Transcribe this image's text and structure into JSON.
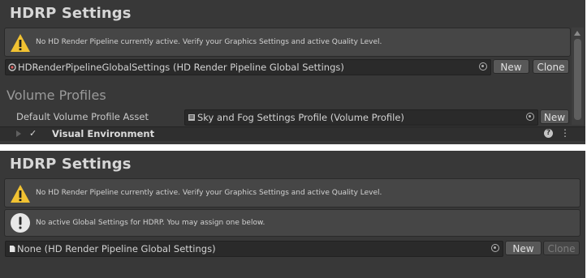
{
  "top": {
    "title": "HDRP Settings",
    "warning": "No HD Render Pipeline currently active. Verify your Graphics Settings and active Quality Level.",
    "global_settings_field": "HDRenderPipelineGlobalSettings (HD Render Pipeline Global Settings)",
    "new_label": "New",
    "clone_label": "Clone",
    "volume_profiles_header": "Volume Profiles",
    "default_profile_label": "Default Volume Profile Asset",
    "default_profile_value": "Sky and Fog Settings Profile (Volume Profile)",
    "profile_new_label": "New",
    "visual_env_label": "Visual Environment",
    "visual_env_checked": "✓"
  },
  "bottom": {
    "title": "HDRP Settings",
    "warning": "No HD Render Pipeline currently active. Verify your Graphics Settings and active Quality Level.",
    "info": "No active Global Settings for HDRP. You may assign one below.",
    "global_settings_field": "None (HD Render Pipeline Global Settings)",
    "new_label": "New",
    "clone_label": "Clone"
  },
  "icons": {
    "warning": "warning-icon",
    "info": "info-icon",
    "picker": "object-picker-icon",
    "asset": "asset-icon",
    "help": "help-icon",
    "menu": "kebab-menu-icon"
  },
  "colors": {
    "panel_bg": "#383838",
    "warning_yellow": "#f1c232",
    "field_bg": "#2a2a2a",
    "button_bg": "#585858"
  }
}
